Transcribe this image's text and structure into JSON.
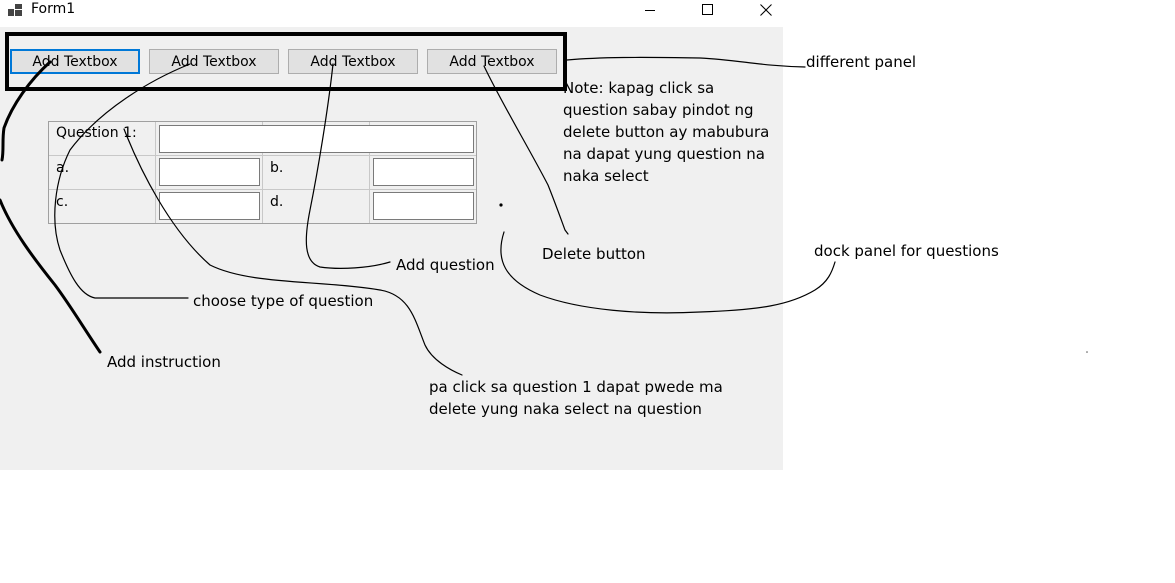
{
  "window": {
    "title": "Form1",
    "controls": [
      "minimize-icon",
      "maximize-icon",
      "close-icon"
    ]
  },
  "toolbar": {
    "buttons": [
      {
        "label": "Add Textbox"
      },
      {
        "label": "Add Textbox"
      },
      {
        "label": "Add Textbox"
      },
      {
        "label": "Add Textbox"
      }
    ]
  },
  "table": {
    "question_label": "Question 1:",
    "option_a": "a.",
    "option_b": "b.",
    "option_c": "c.",
    "option_d": "d."
  },
  "annotations": {
    "different_panel": "different panel",
    "note_lines": [
      "Note: kapag click sa",
      "question sabay pindot ng",
      "delete button ay mabubura",
      "na dapat yung question na",
      "naka select"
    ],
    "delete_button": "Delete button",
    "add_question": "Add question",
    "dock_panel": "dock panel for questions",
    "choose_type": "choose type of question",
    "add_instruction": "Add instruction",
    "click_question": [
      "pa click sa question 1 dapat pwede ma",
      "delete yung naka select na question"
    ]
  }
}
